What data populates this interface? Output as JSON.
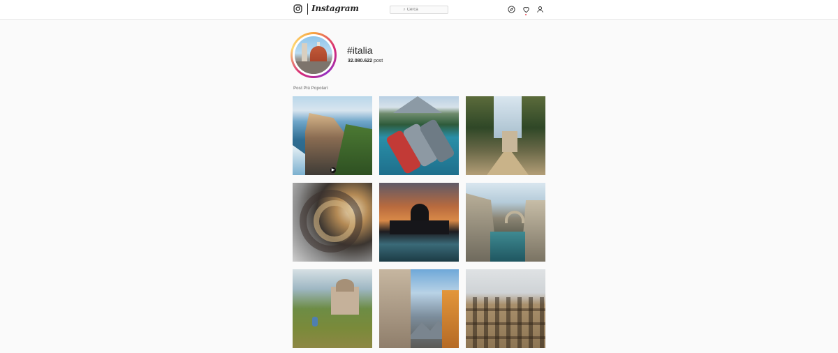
{
  "nav": {
    "logo_text": "Instagram",
    "search_placeholder": "Cerca",
    "icons": [
      "instagram-glyph-icon",
      "compass-icon",
      "heart-icon",
      "user-icon"
    ],
    "notification_dot_color": "#ed4956"
  },
  "header": {
    "hashtag": "#italia",
    "post_count": "32.080.622",
    "post_label": "post"
  },
  "section": {
    "title": "Post Più Popolari"
  },
  "grid": {
    "posts": [
      {
        "name": "post-cinque-terre",
        "video": true
      },
      {
        "name": "post-lake-boats",
        "video": false
      },
      {
        "name": "post-garden-gate",
        "video": false
      },
      {
        "name": "post-spiral-staircase",
        "video": false
      },
      {
        "name": "post-venice-sunset",
        "video": false
      },
      {
        "name": "post-fjord-bridge",
        "video": false
      },
      {
        "name": "post-temple-park",
        "video": false
      },
      {
        "name": "post-alpine-town",
        "video": false
      },
      {
        "name": "post-colosseum",
        "video": false
      }
    ]
  }
}
